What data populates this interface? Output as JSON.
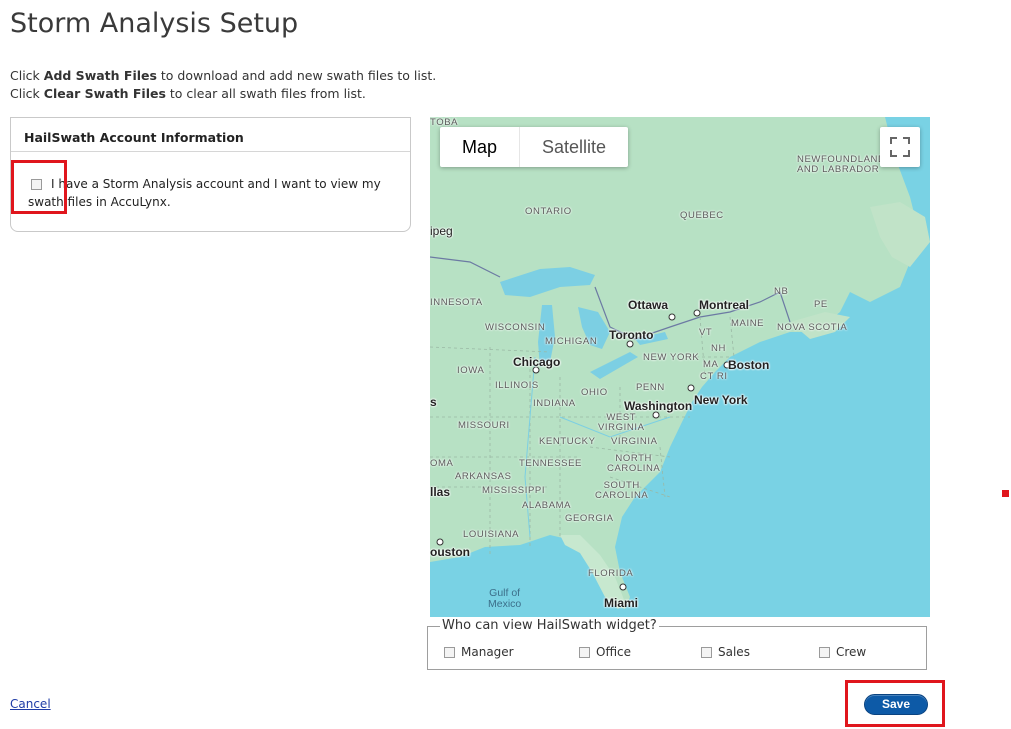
{
  "page": {
    "title": "Storm Analysis Setup",
    "instructions": [
      {
        "prefix": "Click ",
        "bold": "Add Swath Files",
        "suffix": " to download and add new swath files to list."
      },
      {
        "prefix": "Click ",
        "bold": "Clear Swath Files",
        "suffix": " to clear all swath files from list."
      }
    ]
  },
  "account_panel": {
    "header": "HailSwath Account Information",
    "checkbox_label": "I have a Storm Analysis account and I want to view my swath files in AccuLynx.",
    "checked": false
  },
  "map": {
    "type_buttons": {
      "map": "Map",
      "satellite": "Satellite"
    },
    "active_type": "Map",
    "region_labels": {
      "toba": "TOBA",
      "ipeg": "ipeg",
      "ontario": "ONTARIO",
      "quebec": "QUEBEC",
      "newfoundland": "NEWFOUNDLAND\nAND LABRADOR",
      "minnesota": "INNESOTA",
      "wisconsin": "WISCONSIN",
      "michigan": "MICHIGAN",
      "iowa": "IOWA",
      "illinois": "ILLINOIS",
      "indiana": "INDIANA",
      "ohio": "OHIO",
      "penn": "PENN",
      "newyork_state": "NEW YORK",
      "vt": "VT",
      "nh": "NH",
      "maine": "MAINE",
      "nb": "NB",
      "pe": "PE",
      "novascotia": "NOVA SCOTIA",
      "ma": "MA",
      "ctri": "CT RI",
      "missouri": "MISSOURI",
      "kentucky": "KENTUCKY",
      "westvirginia": "WEST\nVIRGINIA",
      "virginia": "VIRGINIA",
      "tennessee": "TENNESSEE",
      "northcarolina": "NORTH\nCAROLINA",
      "oma": "OMA",
      "arkansas": "ARKANSAS",
      "mississippi": "MISSISSIPPI",
      "alabama": "ALABAMA",
      "georgia": "GEORGIA",
      "southcarolina": "SOUTH\nCAROLINA",
      "louisiana": "LOUISIANA",
      "florida": "FLORIDA",
      "s": "s"
    },
    "cities": {
      "ottawa": "Ottawa",
      "montreal": "Montreal",
      "toronto": "Toronto",
      "chicago": "Chicago",
      "boston": "Boston",
      "washington": "Washington",
      "newyork": "New York",
      "dallas": "llas",
      "houston": "ouston",
      "miami": "Miami"
    },
    "water": {
      "gulf": "Gulf of\nMexico"
    }
  },
  "widget": {
    "legend": "Who can view HailSwath widget?",
    "options": [
      {
        "label": "Manager",
        "checked": false
      },
      {
        "label": "Office",
        "checked": false
      },
      {
        "label": "Sales",
        "checked": false
      },
      {
        "label": "Crew",
        "checked": false
      }
    ]
  },
  "footer": {
    "cancel": "Cancel",
    "save": "Save"
  },
  "colors": {
    "save": "#0d5aa7",
    "highlight": "#e0161d",
    "link": "#1f3ca6"
  }
}
